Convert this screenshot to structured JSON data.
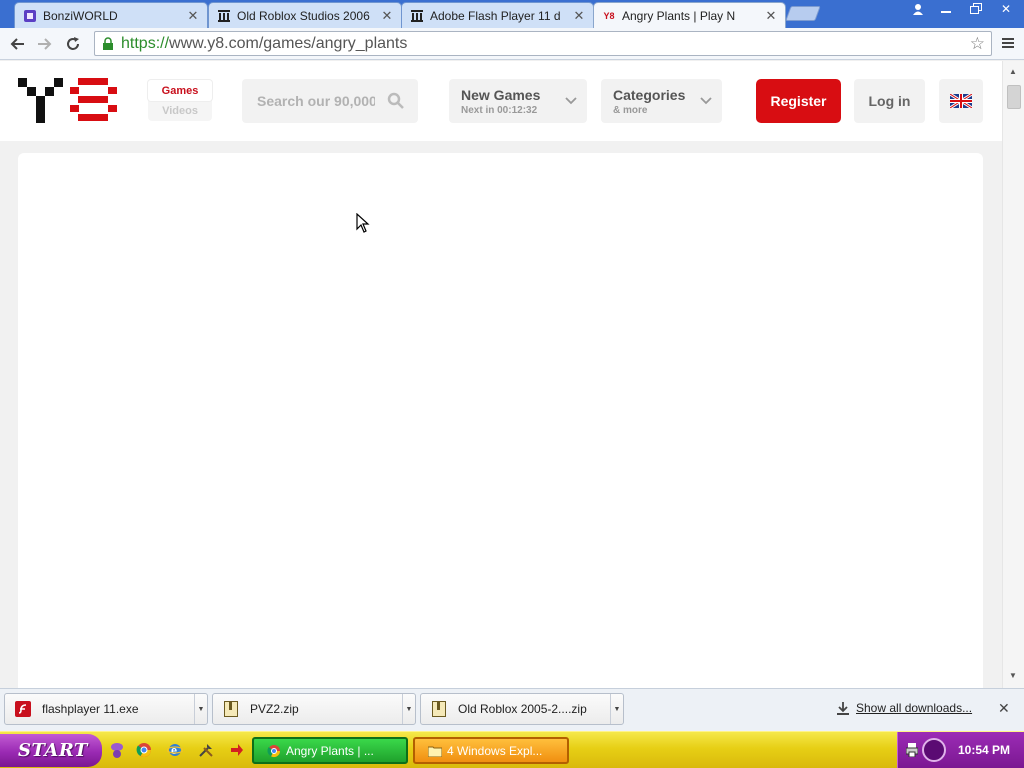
{
  "browser": {
    "tabs": [
      {
        "title": "BonziWORLD",
        "favicon": "bonzi-icon",
        "active": false
      },
      {
        "title": "Old Roblox Studios 2006",
        "favicon": "archive-icon",
        "active": false
      },
      {
        "title": "Adobe Flash Player 11 d",
        "favicon": "archive-icon",
        "active": false
      },
      {
        "title": "Angry Plants | Play N",
        "favicon": "y8-icon",
        "active": true
      }
    ],
    "favicon_y8_text": "Y8",
    "url_scheme": "https://",
    "url_rest": "www.y8.com/games/angry_plants"
  },
  "site": {
    "nav_tabs": {
      "games": "Games",
      "videos": "Videos"
    },
    "search_placeholder": "Search our 90,000",
    "new_games": {
      "label": "New Games",
      "sub": "Next in 00:12:32"
    },
    "categories": {
      "label": "Categories",
      "sub": "& more"
    },
    "register": "Register",
    "login": "Log in",
    "language": "uk-flag-icon",
    "accent_color": "#d80d12"
  },
  "downloads": {
    "items": [
      {
        "name": "flashplayer 11.exe",
        "icon": "flash-file-icon"
      },
      {
        "name": "PVZ2.zip",
        "icon": "zip-file-icon"
      },
      {
        "name": "Old Roblox 2005-2....zip",
        "icon": "zip-file-icon"
      }
    ],
    "show_all": "Show all downloads..."
  },
  "taskbar": {
    "start": "START",
    "tasks": [
      {
        "label": "Angry Plants | ...",
        "icon": "chrome-icon"
      },
      {
        "label": "4 Windows Expl...",
        "icon": "folder-icon"
      }
    ],
    "clock": "10:54 PM"
  }
}
